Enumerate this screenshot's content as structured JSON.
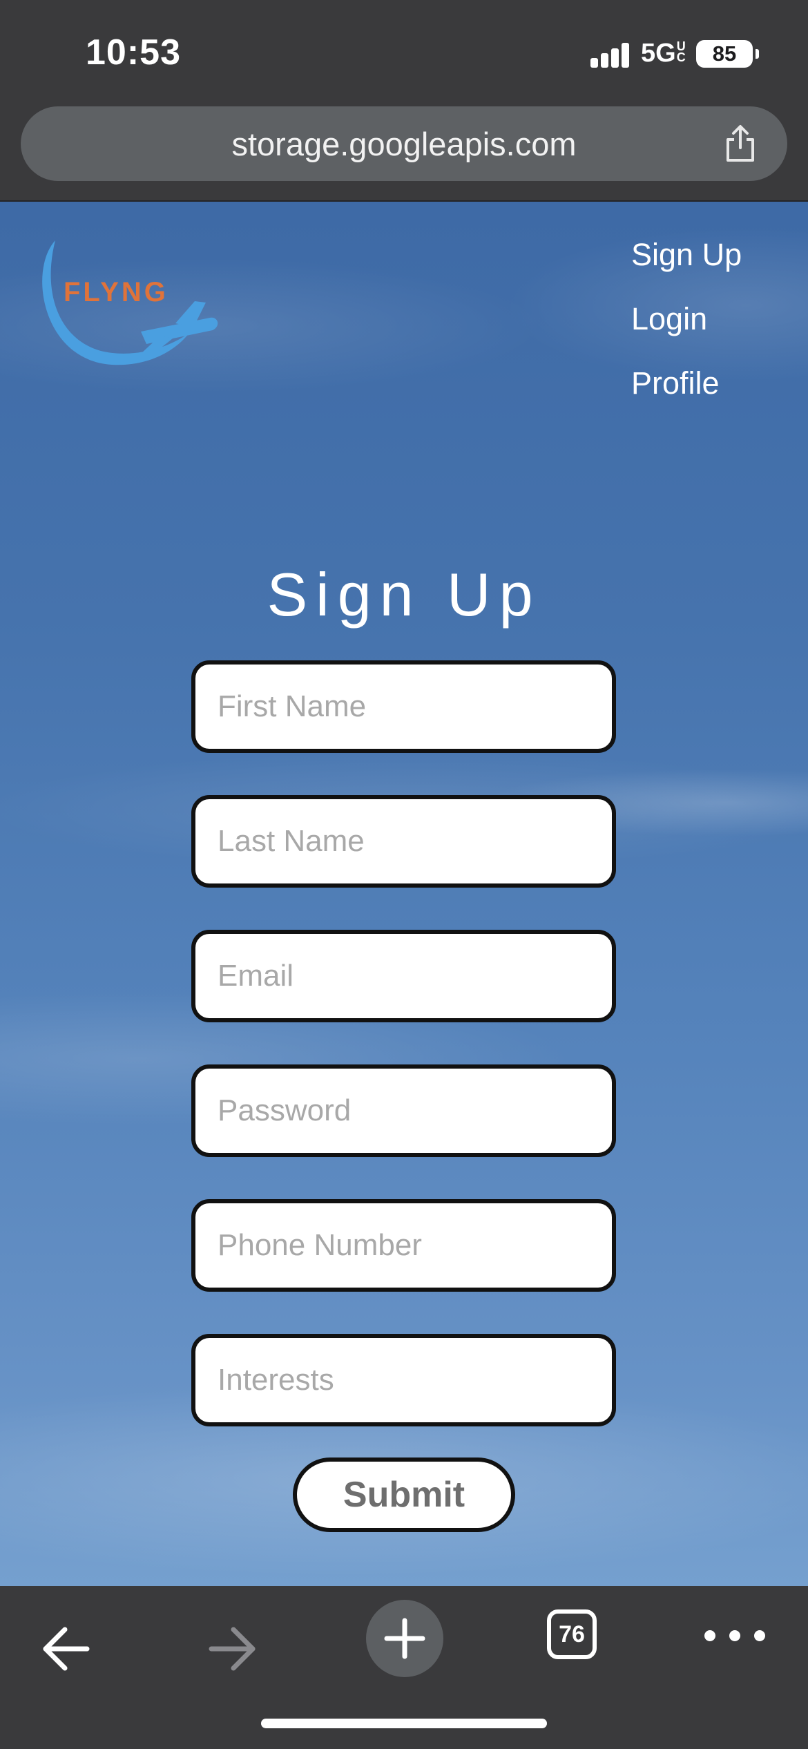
{
  "status_bar": {
    "time": "10:53",
    "network": "5G",
    "network_badge": "UC",
    "battery": "85",
    "icons": [
      "signal-bars-icon",
      "battery-icon"
    ]
  },
  "address_bar": {
    "url": "storage.googleapis.com",
    "share_icon": "share-icon"
  },
  "logo": {
    "text": "FLYNG",
    "icon": "airplane-swoosh-logo",
    "colors": {
      "text": "#e0733a",
      "swoosh": "#4a9fe0"
    }
  },
  "nav": {
    "items": [
      {
        "label": "Sign Up"
      },
      {
        "label": "Login"
      },
      {
        "label": "Profile"
      }
    ]
  },
  "form": {
    "title": "Sign Up",
    "fields": [
      {
        "placeholder": "First Name",
        "value": ""
      },
      {
        "placeholder": "Last Name",
        "value": ""
      },
      {
        "placeholder": "Email",
        "value": ""
      },
      {
        "placeholder": "Password",
        "value": ""
      },
      {
        "placeholder": "Phone Number",
        "value": ""
      },
      {
        "placeholder": "Interests",
        "value": ""
      }
    ],
    "submit_label": "Submit"
  },
  "toolbar": {
    "icons": [
      "back-arrow-icon",
      "forward-arrow-icon",
      "plus-icon",
      "tabs-icon",
      "more-dots-icon"
    ],
    "tab_count": "76"
  },
  "colors": {
    "sky": "#4673ad",
    "chrome_background": "#3a3a3c",
    "url_pill": "#5e6164"
  }
}
